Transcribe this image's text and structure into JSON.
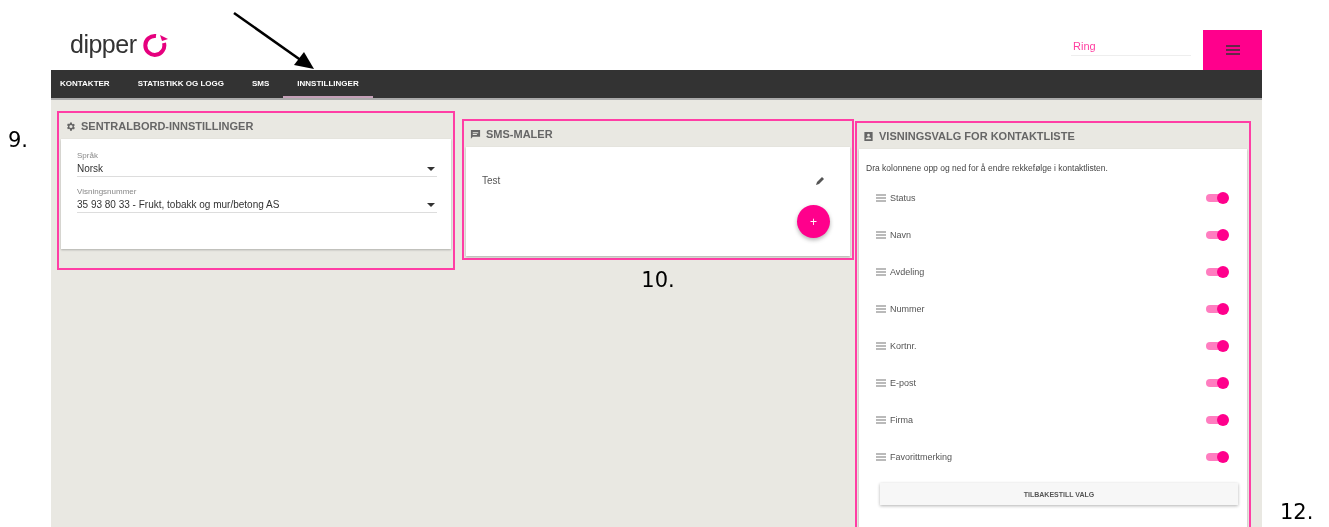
{
  "header": {
    "logo": "dipper",
    "search": {
      "placeholder": "Ring"
    }
  },
  "tabs": [
    {
      "label": "KONTAKTER",
      "selected": false
    },
    {
      "label": "STATISTIKK OG LOGG",
      "selected": false
    },
    {
      "label": "SMS",
      "selected": false
    },
    {
      "label": "INNSTILLINGER",
      "selected": true
    }
  ],
  "switchboard": {
    "title": "SENTRALBORD-INNSTILLINGER",
    "fields": [
      {
        "label": "Språk",
        "value": "Norsk"
      },
      {
        "label": "Visningsnummer",
        "value": "35 93 80 33 - Frukt, tobakk og mur/betong AS"
      }
    ]
  },
  "sms_templates": {
    "title": "SMS-MALER",
    "items": [
      "Test"
    ],
    "add_button": "+"
  },
  "contact_list_view": {
    "title": "VISNINGSVALG FOR KONTAKTLISTE",
    "hint": "Dra kolonnene opp og ned for å endre rekkefølge i kontaktlisten.",
    "columns": [
      {
        "label": "Status",
        "on": true
      },
      {
        "label": "Navn",
        "on": true
      },
      {
        "label": "Avdeling",
        "on": true
      },
      {
        "label": "Nummer",
        "on": true
      },
      {
        "label": "Kortnr.",
        "on": true
      },
      {
        "label": "E-post",
        "on": true
      },
      {
        "label": "Firma",
        "on": true
      },
      {
        "label": "Favorittmerking",
        "on": true
      }
    ],
    "reset_button": "TILBAKESTILL VALG"
  },
  "annotations": {
    "labels": [
      "9.",
      "10.",
      "12."
    ]
  }
}
